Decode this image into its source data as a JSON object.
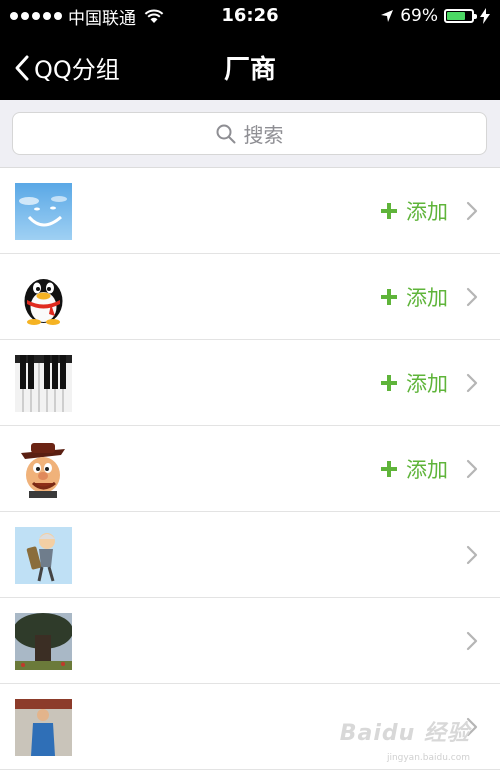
{
  "status_bar": {
    "carrier": "中国联通",
    "time": "16:26",
    "battery_text": "69%",
    "battery_level": 0.69
  },
  "nav": {
    "back_label": "QQ分组",
    "title": "厂商"
  },
  "search": {
    "placeholder": "搜索"
  },
  "list": {
    "add_label": "添加",
    "items": [
      {
        "avatar": "sky-smile-avatar",
        "has_add": true
      },
      {
        "avatar": "qq-penguin-avatar",
        "has_add": true
      },
      {
        "avatar": "piano-keys-avatar",
        "has_add": true
      },
      {
        "avatar": "cartoon-man-hat-avatar",
        "has_add": true
      },
      {
        "avatar": "cartoon-old-man-avatar",
        "has_add": false
      },
      {
        "avatar": "tree-photo-avatar",
        "has_add": false
      },
      {
        "avatar": "person-photo-avatar",
        "has_add": false
      }
    ]
  },
  "watermark": {
    "brand": "Baidu 经验",
    "url": "jingyan.baidu.com"
  },
  "colors": {
    "accent_green": "#5fb43a",
    "nav_bg": "#000000",
    "search_bg": "#efeff4"
  }
}
